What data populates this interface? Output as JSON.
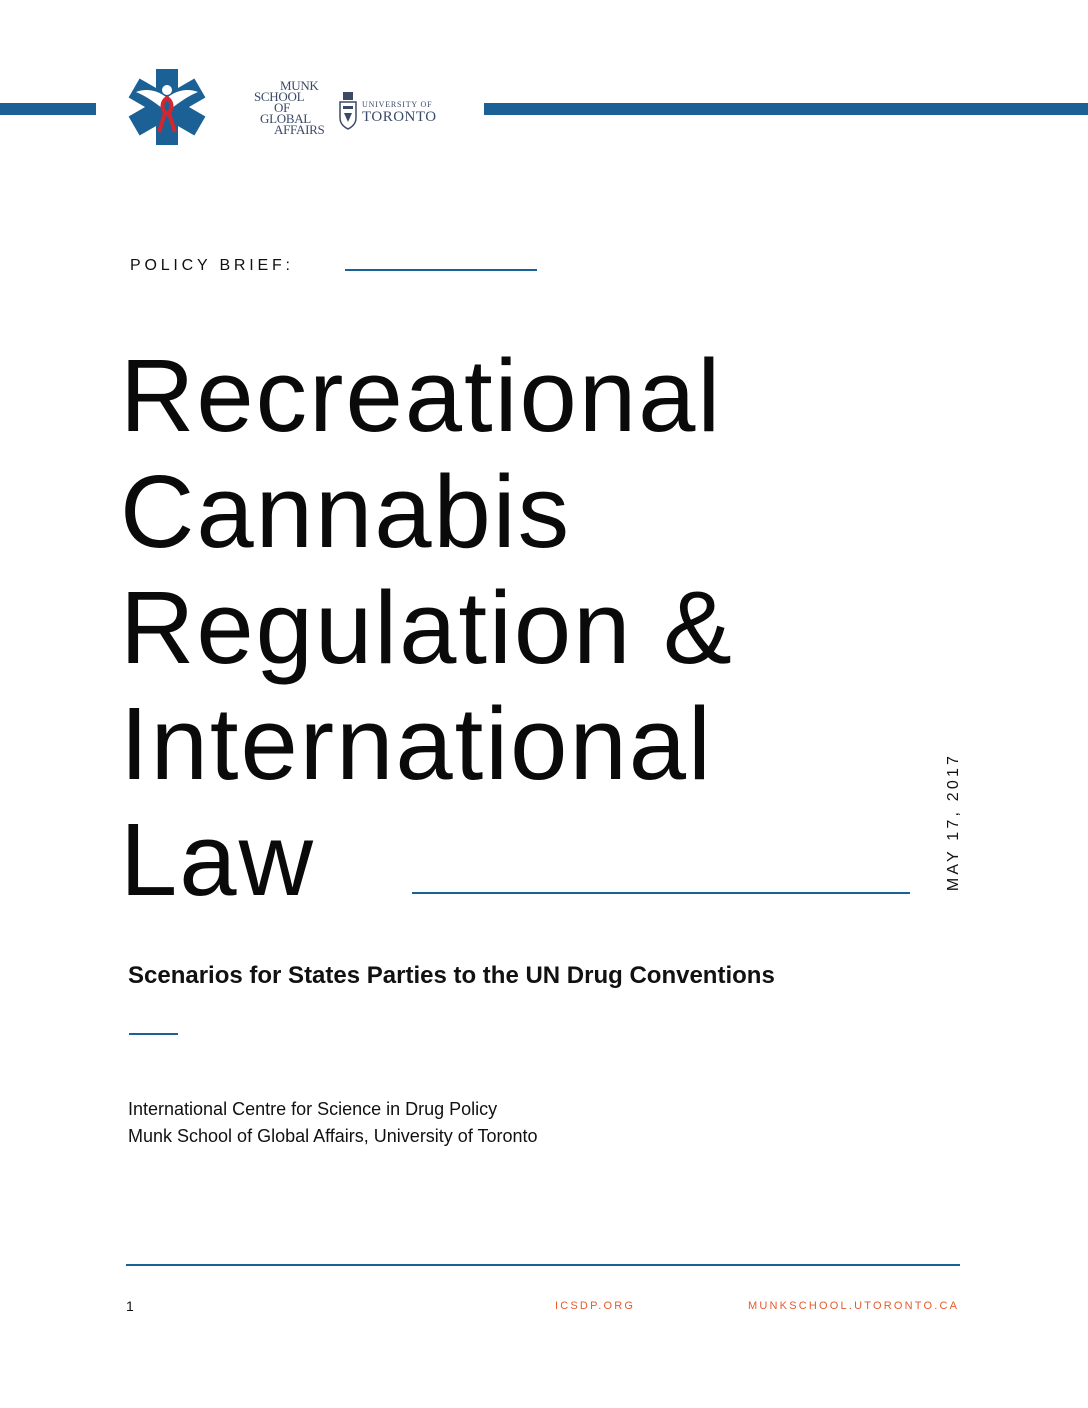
{
  "header": {
    "munk_logo_lines": [
      "MUNK",
      "SCHOOL",
      "OF",
      "GLOBAL",
      "AFFAIRS"
    ],
    "uoft_small": "UNIVERSITY OF",
    "uoft_big": "TORONTO"
  },
  "document": {
    "label": "POLICY BRIEF:",
    "title_lines": [
      "Recreational",
      "Cannabis",
      "Regulation &",
      "International",
      "Law"
    ],
    "date": "MAY 17, 2017",
    "subtitle": "Scenarios for States Parties to the UN Drug Conventions",
    "organizations": [
      "International Centre for Science in Drug Policy",
      "Munk School of Global Affairs, University of Toronto"
    ]
  },
  "footer": {
    "page_number": "1",
    "link_left": "ICSDP.ORG",
    "link_right": "MUNKSCHOOL.UTORONTO.CA"
  },
  "colors": {
    "rule_blue": "#1c6196",
    "footer_link": "#e55b2d",
    "text": "#111111"
  }
}
